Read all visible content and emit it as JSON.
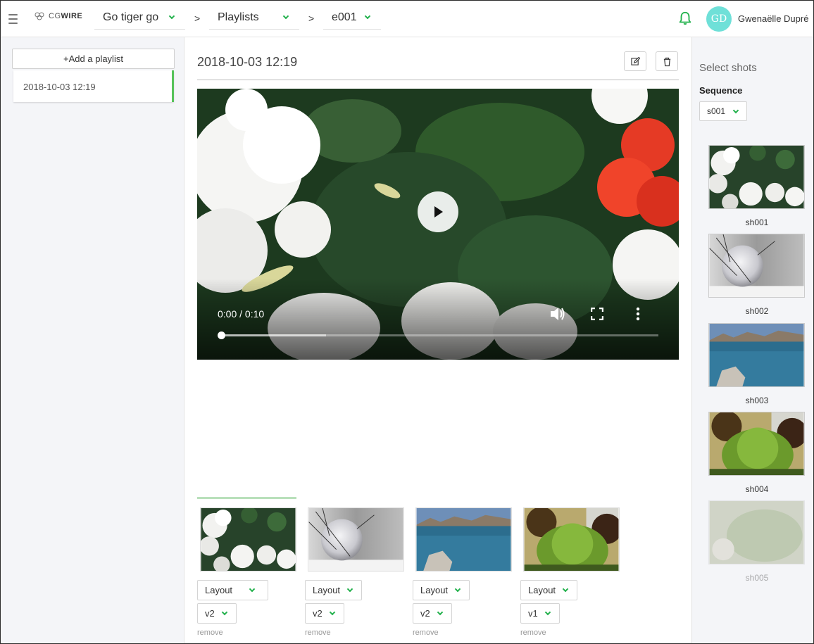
{
  "header": {
    "logo_text_light": "CG",
    "logo_text_bold": "WIRE",
    "breadcrumbs": [
      {
        "label": "Go tiger go"
      },
      {
        "label": "Playlists"
      },
      {
        "label": "e001"
      }
    ],
    "separator": ">",
    "user": {
      "initials": "GD",
      "name": "Gwenaëlle Dupré"
    },
    "colors": {
      "accent": "#22b14c",
      "avatar": "#6fe0d8"
    }
  },
  "left_panel": {
    "add_label": "+Add a playlist",
    "playlists": [
      {
        "label": "2018-10-03 12:19",
        "selected": true
      }
    ]
  },
  "main": {
    "title": "2018-10-03 12:19",
    "edit_icon": "edit-icon",
    "delete_icon": "trash-icon",
    "player": {
      "time": "0:00 / 0:10",
      "progress": 0.0,
      "buffered": 0.24
    },
    "shots": [
      {
        "layout": "Layout",
        "version": "v2",
        "remove": "remove",
        "active": true
      },
      {
        "layout": "Layout",
        "version": "v2",
        "remove": "remove",
        "active": false
      },
      {
        "layout": "Layout",
        "version": "v2",
        "remove": "remove",
        "active": false
      },
      {
        "layout": "Layout",
        "version": "v1",
        "remove": "remove",
        "active": false
      }
    ]
  },
  "right_panel": {
    "title": "Select shots",
    "sequence_label": "Sequence",
    "sequence_value": "s001",
    "shots": [
      {
        "name": "sh001"
      },
      {
        "name": "sh002"
      },
      {
        "name": "sh003"
      },
      {
        "name": "sh004"
      },
      {
        "name": "sh005",
        "disabled": true
      }
    ]
  }
}
